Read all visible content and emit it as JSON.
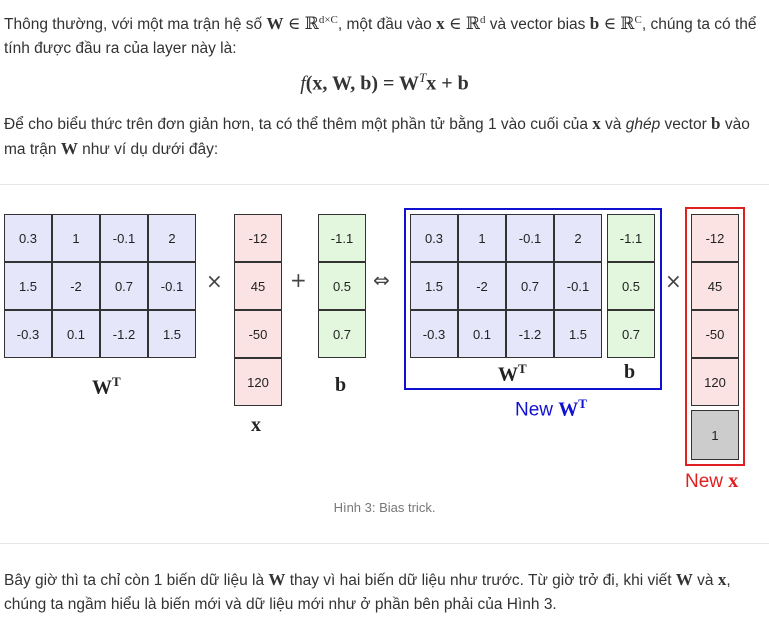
{
  "intro": {
    "p1_a": "Thông thường, với một ma trận hệ số ",
    "p1_b": ", một đầu vào ",
    "p1_c": " và vector bias ",
    "p1_d": ", chúng ta có thể tính được đầu ra của layer này là:",
    "sym_W": "W",
    "sym_in": "∈",
    "sym_R": "ℝ",
    "sym_dxC": "d×C",
    "sym_x": "x",
    "sym_d": "d",
    "sym_b": "b",
    "sym_C": "C"
  },
  "formula": {
    "f": "f",
    "args": "(x, W, b) = W",
    "T": "T",
    "rest": "x + b"
  },
  "p2": {
    "a": "Để cho biểu thức trên đơn giản hơn, ta có thể thêm một phần tử bằng 1 vào cuối của ",
    "b": " và ",
    "ghep": "ghép",
    "c": " vector ",
    "d": " vào ma trận ",
    "e": " như ví dụ dưới đây:"
  },
  "figure": {
    "W_rows": [
      [
        "0.3",
        "1",
        "-0.1",
        "2"
      ],
      [
        "1.5",
        "-2",
        "0.7",
        "-0.1"
      ],
      [
        "-0.3",
        "0.1",
        "-1.2",
        "1.5"
      ]
    ],
    "x_values": [
      "-12",
      "45",
      "-50",
      "120"
    ],
    "b_values": [
      "-1.1",
      "0.5",
      "0.7"
    ],
    "one_value": "1",
    "times": "×",
    "plus": "+",
    "equiv": "⇔",
    "label_WT": "W",
    "label_T": "T",
    "label_x": "x",
    "label_b": "b",
    "new_word": "New",
    "new_W": "W",
    "new_T": "T",
    "new_x": "x",
    "blue_color": "#1010d0",
    "red_color": "#e02020",
    "caption": "Hình 3: Bias trick."
  },
  "p3": {
    "a": "Bây giờ thì ta chỉ còn 1 biến dữ liệu là ",
    "b": " thay vì hai biến dữ liệu như trước. Từ giờ trở đi, khi viết ",
    "c": " và ",
    "d": ", chúng ta ngầm hiểu là biến mới và dữ liệu mới như ở phần bên phải của Hình 3."
  }
}
